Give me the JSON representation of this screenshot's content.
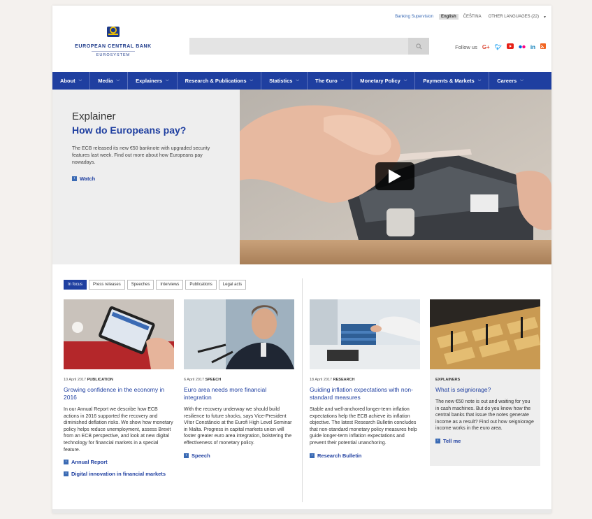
{
  "utility": {
    "banking_supervision": "Banking Supervision",
    "lang_active": "English",
    "lang_other": "ČEŠTINA",
    "other_languages": "OTHER LANGUAGES (22)"
  },
  "logo": {
    "name": "EUROPEAN CENTRAL BANK",
    "sub": "EUROSYSTEM"
  },
  "search": {
    "placeholder": ""
  },
  "follow": {
    "label": "Follow us",
    "icons": [
      "google-plus-icon",
      "twitter-icon",
      "youtube-icon",
      "flickr-icon",
      "linkedin-icon",
      "rss-icon"
    ]
  },
  "nav": [
    {
      "label": "About"
    },
    {
      "label": "Media"
    },
    {
      "label": "Explainers"
    },
    {
      "label": "Research & Publications"
    },
    {
      "label": "Statistics"
    },
    {
      "label": "The €uro"
    },
    {
      "label": "Monetary Policy"
    },
    {
      "label": "Payments & Markets"
    },
    {
      "label": "Careers"
    }
  ],
  "hero": {
    "kicker": "Explainer",
    "title": "How do Europeans pay?",
    "desc": "The ECB released its new €50 banknote with upgraded security features last week. Find out more about how Europeans pay nowadays.",
    "link": "Watch"
  },
  "tabs": [
    "In focus",
    "Press releases",
    "Speeches",
    "Interviews",
    "Publications",
    "Legal acts"
  ],
  "cards": [
    {
      "date": "10 April 2017",
      "type": "PUBLICATION",
      "title": "Growing confidence in the economy in 2016",
      "text": "In our Annual Report we describe how ECB actions in 2016 supported the recovery and diminished deflation risks. We show how monetary policy helps reduce unemployment, assess Brexit from an ECB perspective, and look at new digital technology for financial markets in a special feature.",
      "links": [
        "Annual Report",
        "Digital innovation in financial markets"
      ]
    },
    {
      "date": "6 April 2017",
      "type": "SPEECH",
      "title": "Euro area needs more financial integration",
      "text": "With the recovery underway we should build resilience to future shocks, says Vice-President Vítor Constâncio at the Eurofi High Level Seminar in Malta. Progress in capital markets union will foster greater euro area integration, bolstering the effectiveness of monetary policy.",
      "links": [
        "Speech"
      ]
    },
    {
      "date": "18 April 2017",
      "type": "RESEARCH",
      "title": "Guiding inflation expectations with non-standard measures",
      "text": "Stable and well-anchored longer-term inflation expectations help the ECB achieve its inflation objective. The latest Research Bulletin concludes that non-standard monetary policy measures help guide longer-term inflation expectations and prevent their potential unanchoring.",
      "links": [
        "Research Bulletin"
      ]
    },
    {
      "date": "",
      "type": "EXPLAINERS",
      "title": "What is seigniorage?",
      "text": "The new €50 note is out and waiting for you in cash machines. But do you know how the central banks that issue the notes generate income as a result? Find out how seigniorage income works in the euro area.",
      "links": [
        "Tell me"
      ]
    }
  ],
  "colors": {
    "brand": "#1f3fa0",
    "accent": "#3a6ab4"
  }
}
